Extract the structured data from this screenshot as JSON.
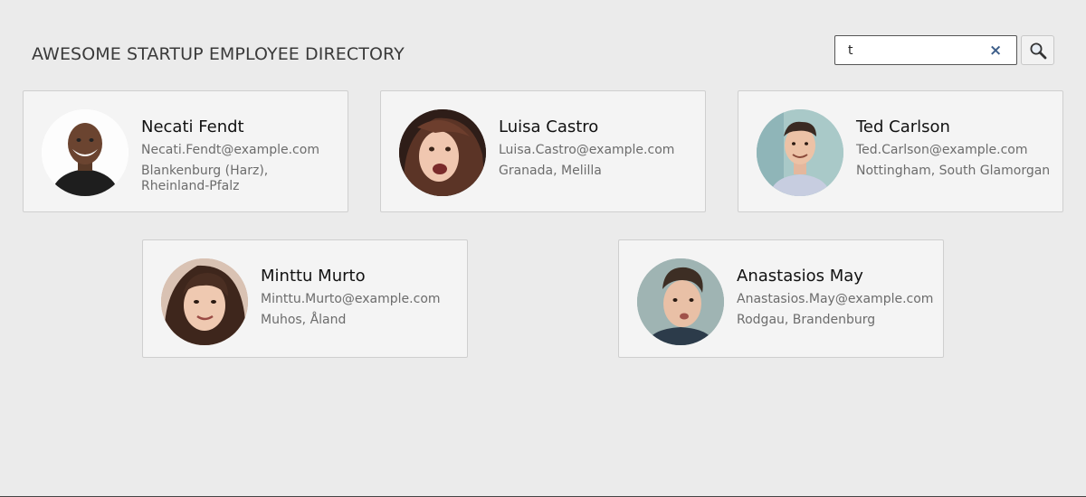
{
  "header": {
    "title": "AWESOME STARTUP EMPLOYEE DIRECTORY"
  },
  "search": {
    "value": "t",
    "clear_glyph": "×",
    "icon": "search-icon"
  },
  "employees": [
    {
      "name": "Necati Fendt",
      "email": "Necati.Fendt@example.com",
      "location": "Blankenburg (Harz), Rheinland-Pfalz"
    },
    {
      "name": "Luisa Castro",
      "email": "Luisa.Castro@example.com",
      "location": "Granada, Melilla"
    },
    {
      "name": "Ted Carlson",
      "email": "Ted.Carlson@example.com",
      "location": "Nottingham, South Glamorgan"
    },
    {
      "name": "Minttu Murto",
      "email": "Minttu.Murto@example.com",
      "location": "Muhos, Åland"
    },
    {
      "name": "Anastasios May",
      "email": "Anastasios.May@example.com",
      "location": "Rodgau, Brandenburg"
    }
  ]
}
